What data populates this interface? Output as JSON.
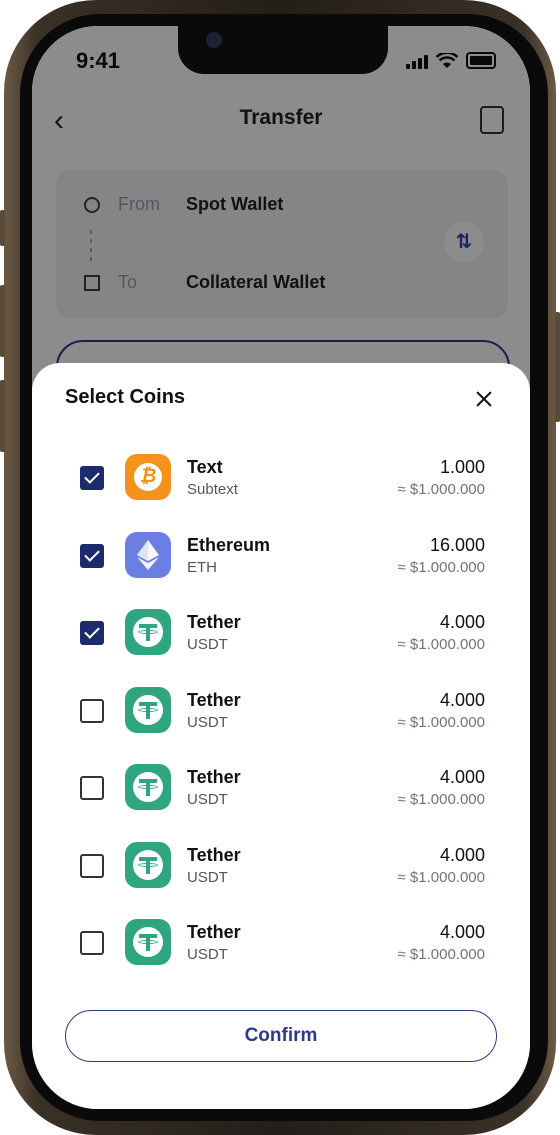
{
  "status": {
    "time": "9:41"
  },
  "header": {
    "title": "Transfer"
  },
  "transfer": {
    "from_label": "From",
    "from_value": "Spot Wallet",
    "to_label": "To",
    "to_value": "Collateral Wallet",
    "swap_symbol": "⇅"
  },
  "sheet": {
    "title": "Select Coins",
    "confirm_label": "Confirm",
    "coins": [
      {
        "name": "Text",
        "sub": "Subtext",
        "amount": "1.000",
        "fiat": "≈ $1.000.000",
        "checked": true,
        "icon": "bitcoin-icon"
      },
      {
        "name": "Ethereum",
        "sub": "ETH",
        "amount": "16.000",
        "fiat": "≈ $1.000.000",
        "checked": true,
        "icon": "ethereum-icon"
      },
      {
        "name": "Tether",
        "sub": "USDT",
        "amount": "4.000",
        "fiat": "≈ $1.000.000",
        "checked": true,
        "icon": "tether-icon"
      },
      {
        "name": "Tether",
        "sub": "USDT",
        "amount": "4.000",
        "fiat": "≈ $1.000.000",
        "checked": false,
        "icon": "tether-icon"
      },
      {
        "name": "Tether",
        "sub": "USDT",
        "amount": "4.000",
        "fiat": "≈ $1.000.000",
        "checked": false,
        "icon": "tether-icon"
      },
      {
        "name": "Tether",
        "sub": "USDT",
        "amount": "4.000",
        "fiat": "≈ $1.000.000",
        "checked": false,
        "icon": "tether-icon"
      },
      {
        "name": "Tether",
        "sub": "USDT",
        "amount": "4.000",
        "fiat": "≈ $1.000.000",
        "checked": false,
        "icon": "tether-icon"
      }
    ]
  },
  "colors": {
    "accent": "#1e2a6e",
    "bitcoin": "#f4921c",
    "ethereum": "#6b7fe3",
    "tether": "#2fa67f"
  }
}
